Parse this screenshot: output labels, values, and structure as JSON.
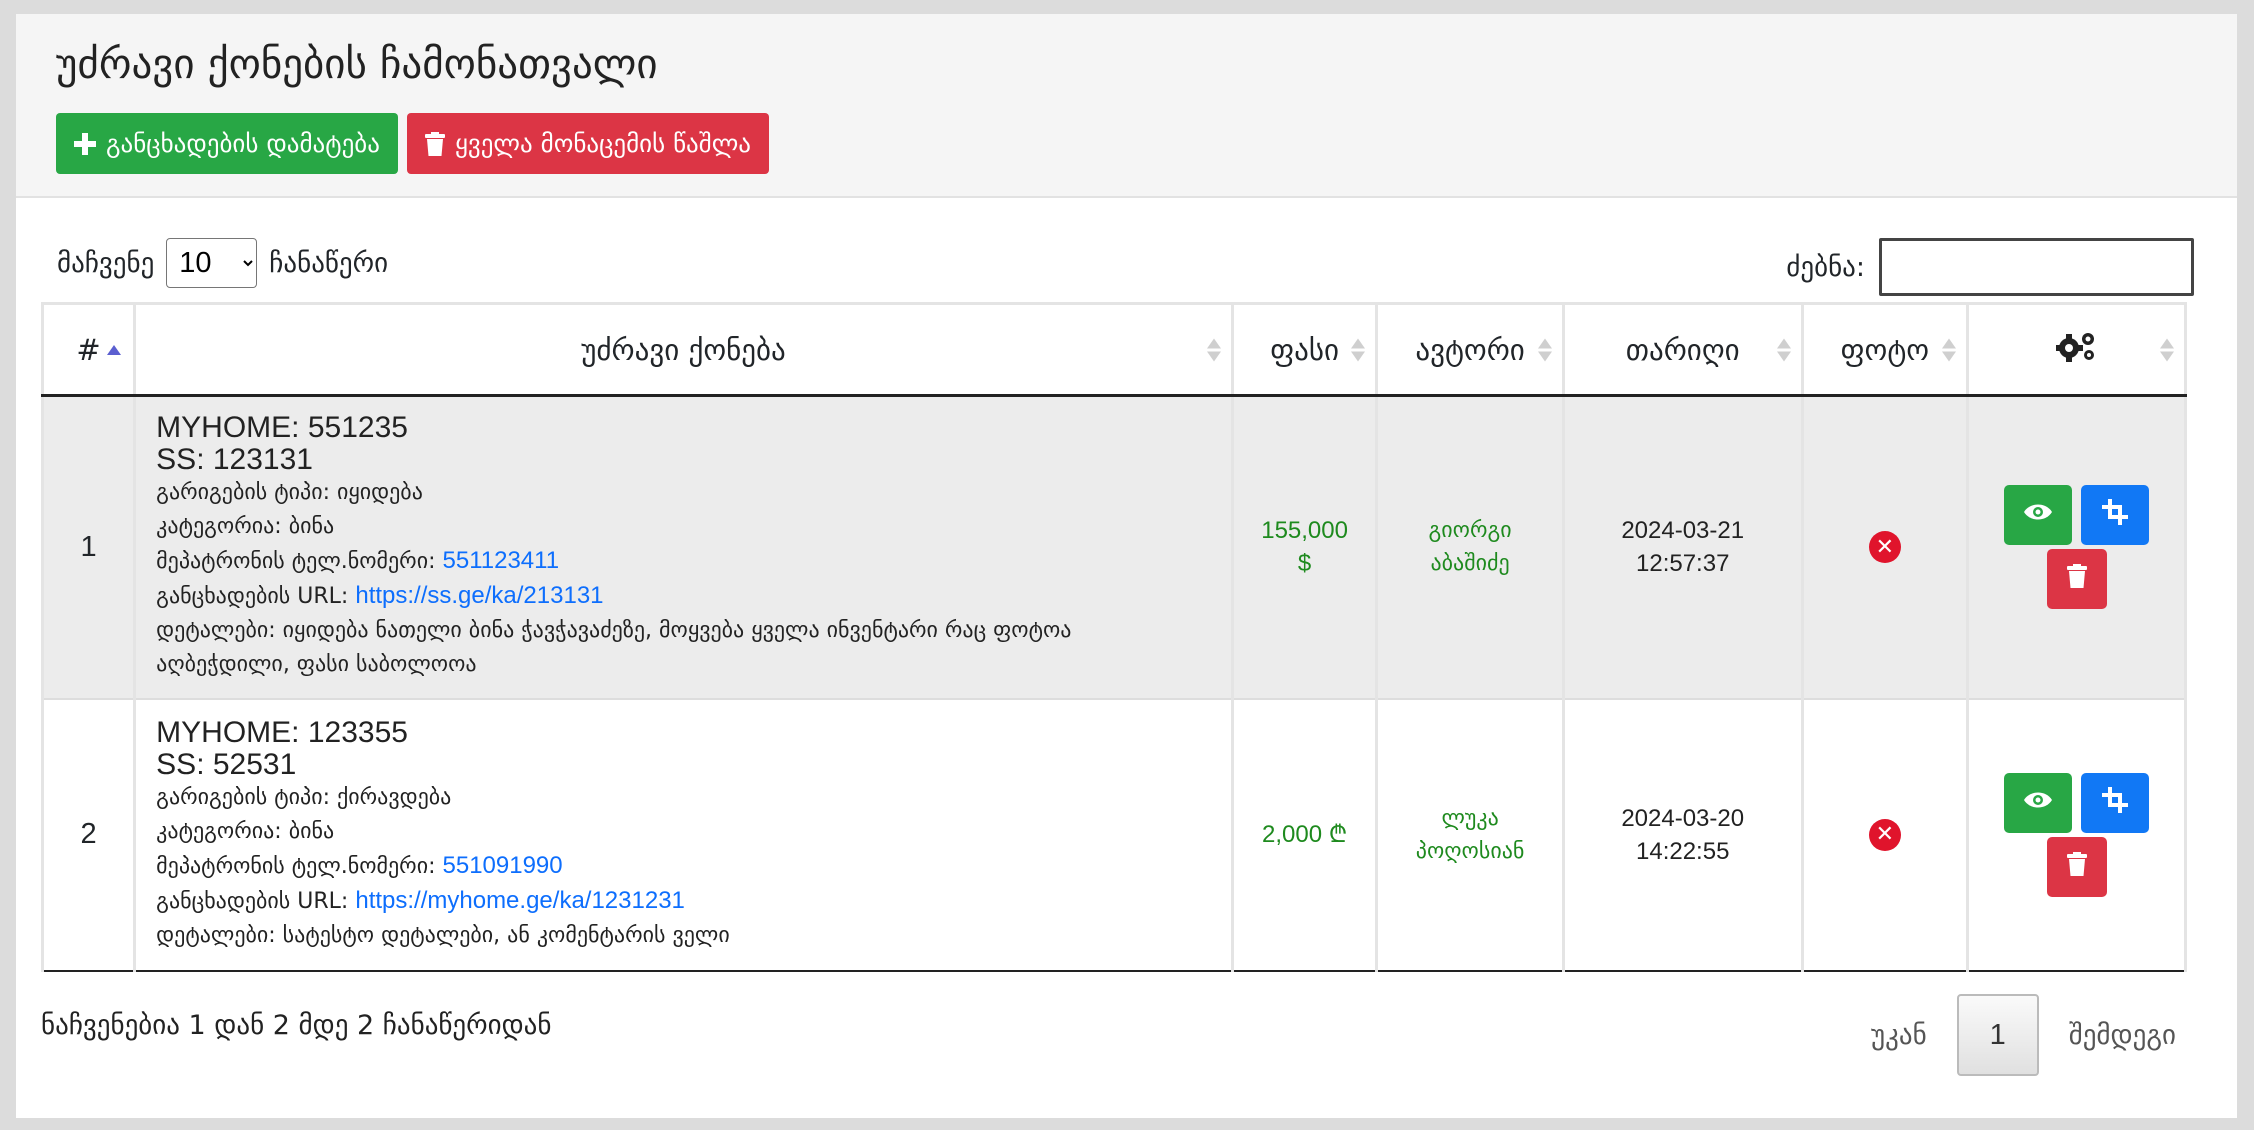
{
  "header": {
    "title": "უძრავი ქონების ჩამონათვალი",
    "add_button": "განცხადების დამატება",
    "delete_all_button": "ყველა მონაცემის წაშლა"
  },
  "controls": {
    "show_label": "მაჩვენე",
    "page_length": "10",
    "entries_label": "ჩანაწერი",
    "search_label": "ძებნა:",
    "search_value": ""
  },
  "table": {
    "columns": [
      "#",
      "უძრავი ქონება",
      "ფასი",
      "ავტორი",
      "თარიღი",
      "ფოტო"
    ],
    "rows": [
      {
        "index": "1",
        "myhome": "MYHOME: 551235",
        "ss": "SS: 123131",
        "deal_type": "გარიგების ტიპი: იყიდება",
        "category": "კატეგორია: ბინა",
        "owner_phone_label": "მეპატრონის ტელ.ნომერი:",
        "owner_phone": "551123411",
        "url_label": "განცხადების URL:",
        "url": "https://ss.ge/ka/213131",
        "details_1": "დეტალები: იყიდება ნათელი ბინა ჭავჭავაძეზე, მოყვება ყველა ინვენტარი რაც ფოტოა",
        "details_2": "აღბეჭდილი, ფასი საბოლოოა",
        "price_1": "155,000",
        "price_2": "$",
        "author_1": "გიორგი",
        "author_2": "აბაშიძე",
        "date": "2024-03-21",
        "time": "12:57:37"
      },
      {
        "index": "2",
        "myhome": "MYHOME: 123355",
        "ss": "SS: 52531",
        "deal_type": "გარიგების ტიპი: ქირავდება",
        "category": "კატეგორია: ბინა",
        "owner_phone_label": "მეპატრონის ტელ.ნომერი:",
        "owner_phone": "551091990",
        "url_label": "განცხადების URL:",
        "url": "https://myhome.ge/ka/1231231",
        "details_1": "დეტალები: სატესტო დეტალები, ან კომენტარის ველი",
        "price_1": "2,000 ₾",
        "author_1": "ლუკა",
        "author_2": "პოღოსიან",
        "date": "2024-03-20",
        "time": "14:22:55"
      }
    ]
  },
  "footer": {
    "info": "ნაჩვენებია 1 დან 2 მდე 2 ჩანაწერიდან",
    "prev": "უკან",
    "page": "1",
    "next": "შემდეგი"
  },
  "colors": {
    "green": "#28a745",
    "red": "#dc3545",
    "blue": "#1178f5",
    "link": "#0d6efd"
  },
  "icons": [
    "plus-icon",
    "trash-icon",
    "gears-icon",
    "eye-icon",
    "crop-icon",
    "x-circle-icon",
    "sort-icon"
  ]
}
